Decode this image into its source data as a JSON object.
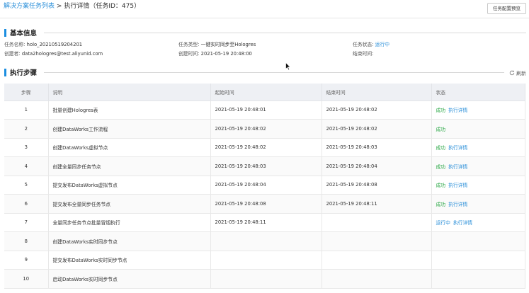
{
  "breadcrumb": {
    "link": "解决方案任务列表",
    "separator": ">",
    "current": "执行详情（任务ID：475）"
  },
  "top_button": "任务配置预览",
  "basic_info": {
    "title": "基本信息",
    "task_name_label": "任务名称:",
    "task_name": "holo_20210519204201",
    "task_type_label": "任务类型:",
    "task_type": "一键实时同步至Hologres",
    "task_status_label": "任务状态:",
    "task_status": "运行中",
    "creator_label": "创建者:",
    "creator": "data2hologres@test.aliyunid.com",
    "create_time_label": "创建时间:",
    "create_time": "2021-05-19 20:48:00",
    "end_time_label": "结束时间:",
    "end_time": ""
  },
  "steps": {
    "title": "执行步骤",
    "refresh_label": "刷新",
    "columns": [
      "步骤",
      "说明",
      "起始时间",
      "结束时间",
      "状态"
    ],
    "rows": [
      {
        "step": "1",
        "desc": "批量创建Hologres表",
        "start": "2021-05-19 20:48:01",
        "end": "2021-05-19 20:48:02",
        "status": "成功",
        "action": "执行详情"
      },
      {
        "step": "2",
        "desc": "创建DataWorks工作流程",
        "start": "2021-05-19 20:48:02",
        "end": "2021-05-19 20:48:02",
        "status": "成功",
        "action": ""
      },
      {
        "step": "3",
        "desc": "创建DataWorks虚拟节点",
        "start": "2021-05-19 20:48:02",
        "end": "2021-05-19 20:48:03",
        "status": "成功",
        "action": "执行详情"
      },
      {
        "step": "4",
        "desc": "创建全量同步任务节点",
        "start": "2021-05-19 20:48:03",
        "end": "2021-05-19 20:48:04",
        "status": "成功",
        "action": "执行详情"
      },
      {
        "step": "5",
        "desc": "提交发布DataWorks虚拟节点",
        "start": "2021-05-19 20:48:04",
        "end": "2021-05-19 20:48:08",
        "status": "成功",
        "action": "执行详情"
      },
      {
        "step": "6",
        "desc": "提交发布全量同步任务节点",
        "start": "2021-05-19 20:48:08",
        "end": "2021-05-19 20:48:11",
        "status": "成功",
        "action": "执行详情"
      },
      {
        "step": "7",
        "desc": "全量同步任务节点批量冒烟执行",
        "start": "2021-05-19 20:48:11",
        "end": "",
        "status": "运行中",
        "action": "执行详情"
      },
      {
        "step": "8",
        "desc": "创建DataWorks实时同步节点",
        "start": "",
        "end": "",
        "status": "",
        "action": ""
      },
      {
        "step": "9",
        "desc": "提交发布DataWorks实时同步节点",
        "start": "",
        "end": "",
        "status": "",
        "action": ""
      },
      {
        "step": "10",
        "desc": "启动DataWorks实时同步节点",
        "start": "",
        "end": "",
        "status": "",
        "action": ""
      }
    ]
  },
  "colors": {
    "accent": "#1b8ee0",
    "link": "#2a8fd9",
    "success": "#2aa845"
  }
}
